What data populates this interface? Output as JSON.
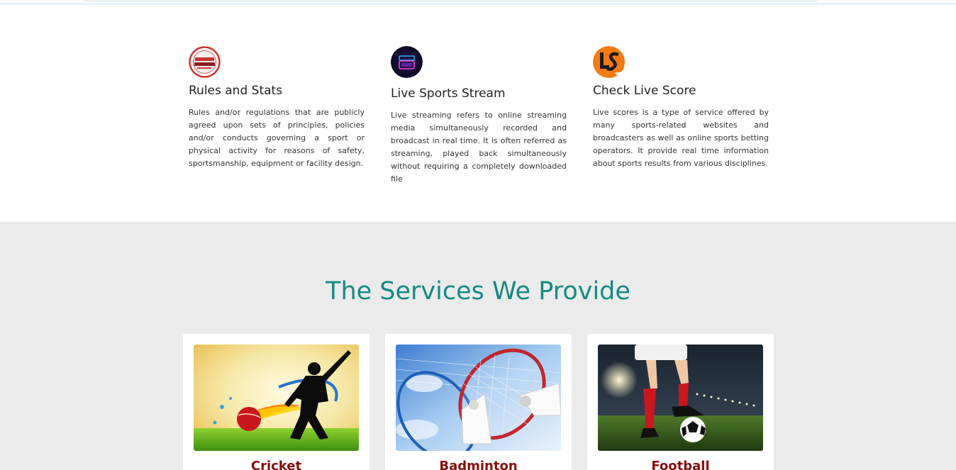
{
  "features": [
    {
      "icon": "rules-regulations-icon",
      "title": "Rules and Stats",
      "text": "Rules and/or regulations that are publicly agreed upon sets of principles, policies and/or conducts governing a sport or physical activity for reasons of safety, sportsmanship, equipment or facility design."
    },
    {
      "icon": "watch-live-icon",
      "title": "Live Sports Stream",
      "text": "Live streaming refers to online streaming media simultaneously recorded and broadcast in real time. It is often referred as streaming, played back simultaneously without requiring a completely downloaded file"
    },
    {
      "icon": "live-score-logo-icon",
      "title": "Check Live Score",
      "text": "Live scores is a type of service offered by many sports-related websites and broadcasters as well as online sports betting operators. It provide real time information about sports results from various disciplines."
    }
  ],
  "services": {
    "heading": "The Services We Provide",
    "cards": [
      {
        "title": "Cricket",
        "image": "cricket-batsman-image"
      },
      {
        "title": "Badminton",
        "image": "badminton-racket-shuttlecock-image"
      },
      {
        "title": "Football",
        "image": "football-player-stadium-image"
      }
    ]
  },
  "colors": {
    "accent": "#138a84",
    "card_title": "#8b0d0d",
    "section_bg": "#ebebeb"
  }
}
